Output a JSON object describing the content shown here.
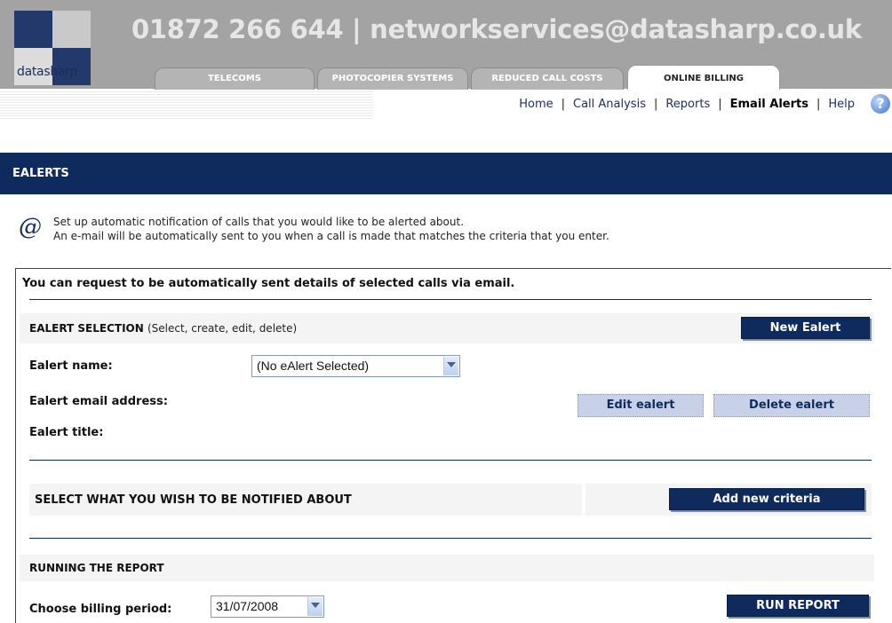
{
  "header": {
    "logo_text": "datasharp",
    "contact": "01872 266 644 | networkservices@datasharp.co.uk",
    "tabs": [
      {
        "label": "TELECOMS"
      },
      {
        "label": "PHOTOCOPIER SYSTEMS"
      },
      {
        "label": "REDUCED CALL COSTS"
      },
      {
        "label": "ONLINE BILLING"
      }
    ]
  },
  "nav": {
    "links": [
      "Home",
      "Call Analysis",
      "Reports",
      "Email Alerts",
      "Help"
    ],
    "separator": "|",
    "help_icon_glyph": "?"
  },
  "page": {
    "title": "EALERTS",
    "intro_icon": "@",
    "intro_line1": "Set up automatic notification of calls that you would like to be alerted about.",
    "intro_line2": "An e-mail will be automatically sent to you when a call is made that matches the criteria that you enter."
  },
  "panel": {
    "heading": "You can request to be automatically sent details of selected calls via email.",
    "selection": {
      "label": "EALERT SELECTION",
      "sublabel": "(Select, create, edit, delete)",
      "new_button": "New Ealert",
      "name_label": "Ealert name:",
      "name_value": "(No eAlert Selected)",
      "email_label": "Ealert email address:",
      "title_label": "Ealert title:",
      "edit_button": "Edit ealert",
      "delete_button": "Delete ealert"
    },
    "criteria": {
      "label": "SELECT WHAT YOU WISH TO BE NOTIFIED ABOUT",
      "add_button": "Add new criteria"
    },
    "report": {
      "label": "RUNNING THE REPORT",
      "period_label": "Choose billing period:",
      "period_value": "31/07/2008",
      "run_button": "RUN REPORT"
    }
  }
}
